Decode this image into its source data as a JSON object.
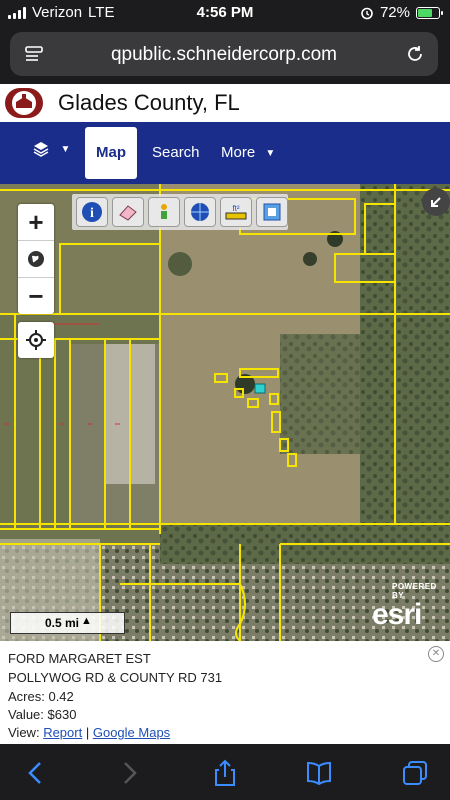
{
  "status": {
    "carrier": "Verizon",
    "network": "LTE",
    "time": "4:56 PM",
    "battery_pct_text": "72%",
    "battery_level": 0.72,
    "icons": [
      "alarm-icon",
      "charging-icon"
    ]
  },
  "browser": {
    "url": "qpublic.schneidercorp.com",
    "left_icon": "reader-icon",
    "right_icon": "reload-icon"
  },
  "site": {
    "title": "Glades County, FL",
    "seal_icon": "county-seal-logo"
  },
  "nav": {
    "layers_icon": "layers-icon",
    "tabs": [
      {
        "label": "Map",
        "active": true
      },
      {
        "label": "Search",
        "active": false
      },
      {
        "label": "More",
        "active": false
      }
    ],
    "active_color": "#1b2d8a"
  },
  "map": {
    "zoom_in": "+",
    "zoom_out": "−",
    "tools": [
      "identify-icon",
      "eraser-icon",
      "pan-icon",
      "globe-layer-icon",
      "measure-icon",
      "print-icon"
    ],
    "scale_label": "0.5 mi",
    "attribution_powered": "POWERED BY",
    "attribution_brand": "esri",
    "parcel_color": "#f4e400",
    "selected_color": "#2ecfd0"
  },
  "info": {
    "owner": "FORD MARGARET EST",
    "address": "POLLYWOG RD & COUNTY RD 731",
    "acres_label": "Acres:",
    "acres": "0.42",
    "value_label": "Value:",
    "value": "$630",
    "view_label": "View:",
    "link_report": "Report",
    "separator": "|",
    "link_google": "Google Maps"
  },
  "toolbar_icons": [
    "back-icon",
    "forward-icon",
    "share-icon",
    "bookmarks-icon",
    "tabs-icon"
  ]
}
